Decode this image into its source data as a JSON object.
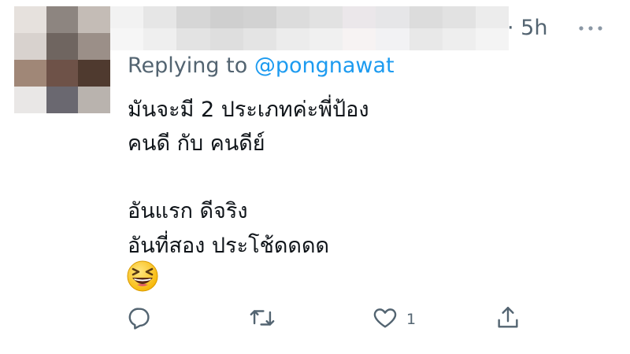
{
  "tweet": {
    "timestamp": "· 5h",
    "replying_prefix": "Replying to",
    "replying_handle": "@pongnawat",
    "lines": [
      "มันจะมี 2 ประเภทค่ะพี่ป้อง",
      "คนดี กับ คนดีย์",
      "",
      "อันแรก ดีจริง",
      "อันที่สอง ประโช้ดดดด"
    ],
    "emoji_name": "grinning-squinting-face",
    "like_count": "1"
  },
  "icons": {
    "more": "more-dots-icon",
    "reply": "reply-bubble-icon",
    "retweet": "retweet-icon",
    "like": "heart-icon",
    "share": "share-icon"
  },
  "colors": {
    "muted_text": "#536471",
    "link": "#1d9bf0",
    "text": "#0f1419"
  }
}
